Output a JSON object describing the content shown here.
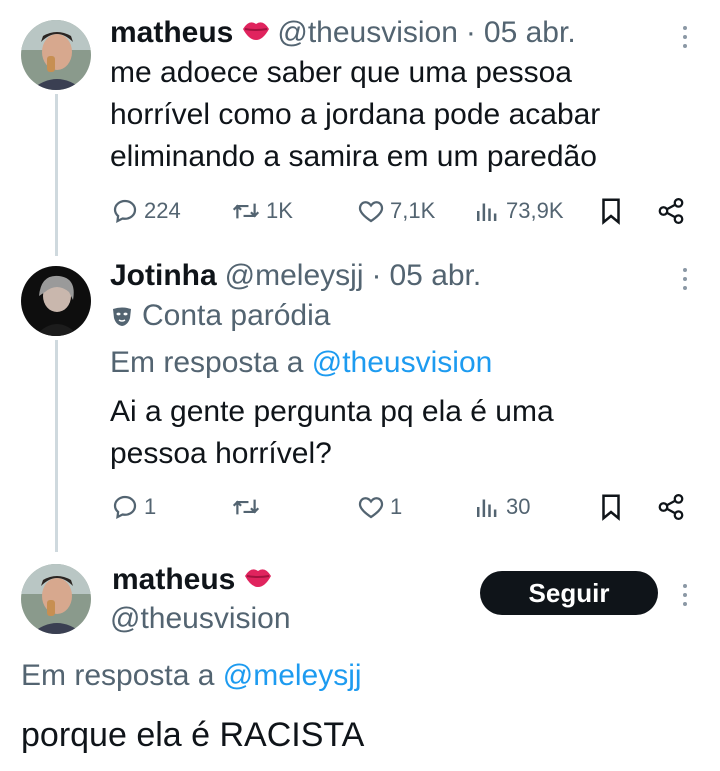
{
  "tweet1": {
    "name": "matheus",
    "handle": "@theusvision",
    "separator": "·",
    "date": "05 abr.",
    "text_lines": [
      "me adoece saber que uma pessoa",
      "horrível como a jordana pode acabar",
      "eliminando a samira em um paredão"
    ],
    "replies": "224",
    "retweets": "1K",
    "likes": "7,1K",
    "views": "73,9K"
  },
  "tweet2": {
    "name": "Jotinha",
    "handle": "@meleysjj",
    "separator": "·",
    "date": "05 abr.",
    "parody_label": "Conta paródia",
    "reply_prefix": "Em resposta a",
    "reply_mention": "@theusvision",
    "text_lines": [
      "Ai a gente pergunta pq ela é uma",
      "pessoa horrível?"
    ],
    "replies": "1",
    "retweets": "",
    "likes": "1",
    "views": "30"
  },
  "tweet3": {
    "name": "matheus",
    "handle": "@theusvision",
    "follow_label": "Seguir",
    "reply_prefix": "Em resposta a",
    "reply_mention": "@meleysjj",
    "text": "porque ela é RACISTA"
  },
  "colors": {
    "text": "#0f1419",
    "secondary": "#536471",
    "link": "#1d9bf0",
    "thread_line": "#cfd9de",
    "lips": "#e0245e"
  },
  "icons": [
    "reply-icon",
    "retweet-icon",
    "like-icon",
    "views-icon",
    "bookmark-icon",
    "share-icon",
    "more-icon",
    "lips-icon",
    "parody-mask-icon"
  ]
}
